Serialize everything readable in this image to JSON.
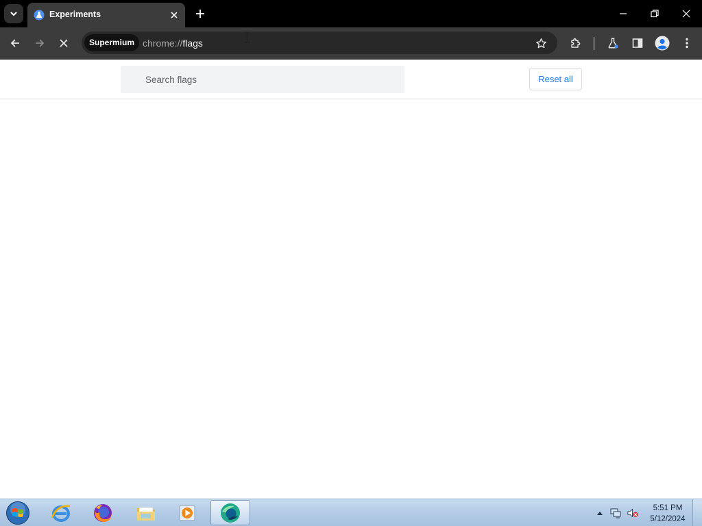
{
  "colors": {
    "tabstrip_bg": "#000000",
    "toolbar_bg": "#3c3c3c",
    "omnibox_bg": "#282828",
    "accent_blue": "#1a73e8",
    "page_bg": "#ffffff",
    "search_bg": "#f1f3f4"
  },
  "tab": {
    "title": "Experiments",
    "favicon": "experiments-flask-icon"
  },
  "window_controls": [
    "minimize-icon",
    "restore-icon",
    "close-icon"
  ],
  "address": {
    "chip_label": "Supermium",
    "scheme": "chrome://",
    "path": "flags"
  },
  "toolbar_icons": [
    "back-arrow-icon",
    "forward-arrow-icon",
    "stop-loading-icon",
    "bookmark-star-icon",
    "extensions-puzzle-icon",
    "labs-flask-icon",
    "side-panel-icon",
    "profile-avatar-icon",
    "menu-kebab-icon"
  ],
  "flags_page": {
    "search_placeholder": "Search flags",
    "reset_label": "Reset all"
  },
  "taskbar": {
    "pinned": [
      "internet-explorer-icon",
      "firefox-icon",
      "file-explorer-icon",
      "media-player-icon",
      "supermium-browser-icon"
    ],
    "active_app": "supermium-browser-icon",
    "tray_icons": [
      "show-hidden-icons-arrow",
      "network-icon",
      "volume-muted-icon"
    ],
    "clock_time": "5:51 PM",
    "clock_date": "5/12/2024"
  }
}
